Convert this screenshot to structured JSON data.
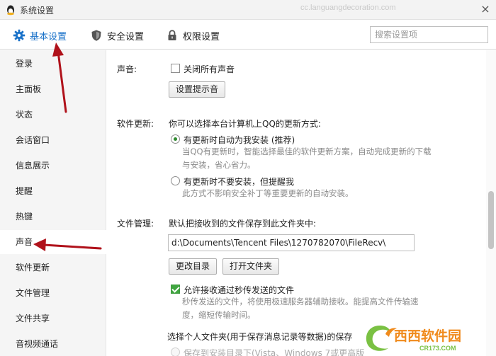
{
  "window": {
    "title": "系统设置",
    "watermark_url": "cc.languangdecoration.com",
    "close_glyph": "×"
  },
  "tabs": [
    {
      "label": "基本设置",
      "icon": "gear-icon",
      "active": true
    },
    {
      "label": "安全设置",
      "icon": "shield-icon",
      "active": false
    },
    {
      "label": "权限设置",
      "icon": "lock-icon",
      "active": false
    }
  ],
  "search": {
    "placeholder": "搜索设置项",
    "value": ""
  },
  "sidebar": {
    "items": [
      {
        "label": "登录"
      },
      {
        "label": "主面板"
      },
      {
        "label": "状态"
      },
      {
        "label": "会话窗口"
      },
      {
        "label": "信息展示"
      },
      {
        "label": "提醒"
      },
      {
        "label": "热键"
      },
      {
        "label": "声音",
        "active": true
      },
      {
        "label": "软件更新"
      },
      {
        "label": "文件管理"
      },
      {
        "label": "文件共享"
      },
      {
        "label": "音视频通话"
      }
    ]
  },
  "sound": {
    "label": "声音:",
    "mute_all": {
      "label": "关闭所有声音",
      "checked": false
    },
    "set_tone_button": "设置提示音"
  },
  "update": {
    "label": "软件更新:",
    "intro": "你可以选择本台计算机上QQ的更新方式:",
    "option_auto": {
      "label": "有更新时自动为我安装 (推荐)",
      "checked": true,
      "desc_line1": "当QQ有更新时，智能选择最佳的软件更新方案，自动完成更新的下载",
      "desc_line2": "与安装，省心省力。"
    },
    "option_remind": {
      "label": "有更新时不要安装，但提醒我",
      "checked": false,
      "desc": "此方式不影响安全补丁等重要更新的自动安装。"
    }
  },
  "files": {
    "label": "文件管理:",
    "intro": "默认把接收到的文件保存到此文件夹中:",
    "path": "d:\\Documents\\Tencent Files\\1270782070\\FileRecv\\",
    "change_dir_button": "更改目录",
    "open_folder_button": "打开文件夹",
    "allow_instant": {
      "label": "允许接收通过秒传发送的文件",
      "checked": true,
      "desc_line1": "秒传发送的文件，将使用极速服务器辅助接收。能提高文件传输速",
      "desc_line2": "度，缩短传输时间。"
    },
    "personal_folder_intro": "选择个人文件夹(用于保存消息记录等数据)的保存",
    "save_install_dir": "保存到安装目录下(Vista、Windows 7或更高版"
  },
  "logo": {
    "text": "西西软件园",
    "subtext": "CR173.COM"
  },
  "colors": {
    "accent": "#1a72c9",
    "check_green": "#40a640",
    "arrow_red": "#b0121b",
    "logo_green": "#7ac143",
    "logo_orange": "#f08a1c"
  }
}
